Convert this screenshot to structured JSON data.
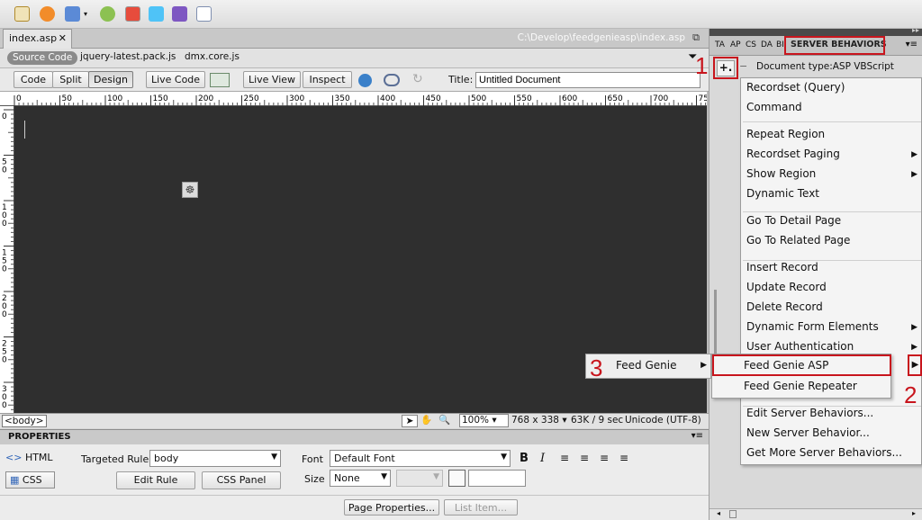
{
  "document": {
    "tabs": [
      {
        "label": "index.asp"
      }
    ],
    "path": "C:\\Develop\\feedgenieasp\\index.asp",
    "source_code": "Source Code",
    "related_files": [
      "jquery-latest.pack.js",
      "dmx.core.js"
    ]
  },
  "view_buttons": {
    "code": "Code",
    "split": "Split",
    "design": "Design",
    "live_code": "Live Code",
    "live_view": "Live View",
    "inspect": "Inspect",
    "title_label": "Title:",
    "title_value": "Untitled Document"
  },
  "ruler": {
    "h_ticks": [
      "0",
      "50",
      "100",
      "150",
      "200",
      "250",
      "300",
      "350",
      "400",
      "450",
      "500",
      "550",
      "600",
      "650",
      "700",
      "750"
    ],
    "v_ticks": [
      "0",
      "50",
      "100",
      "150",
      "200",
      "250",
      "300"
    ]
  },
  "status": {
    "tag": "<body>",
    "zoom": "100%",
    "size": "768 x 338",
    "download": "63K / 9 sec",
    "encoding": "Unicode (UTF-8)"
  },
  "properties": {
    "title": "PROPERTIES",
    "html_button": "HTML",
    "css_button": "CSS",
    "targeted_rule_label": "Targeted Rule",
    "targeted_rule_value": "body",
    "edit_rule": "Edit Rule",
    "css_panel": "CSS Panel",
    "font_label": "Font",
    "font_value": "Default Font",
    "size_label": "Size",
    "size_value": "None",
    "page_properties": "Page Properties...",
    "list_item": "List Item..."
  },
  "panel": {
    "tabs": [
      "TA",
      "AP",
      "CS",
      "DA",
      "BI"
    ],
    "active_tab": "SERVER BEHAVIORS",
    "plus": "+.",
    "minus": "−",
    "doc_type": "Document type:ASP VBScript"
  },
  "menu": {
    "items": [
      {
        "label": "Recordset (Query)",
        "sub": false
      },
      {
        "label": "Command",
        "sub": false
      },
      {
        "label": "Repeat Region",
        "sub": false
      },
      {
        "label": "Recordset Paging",
        "sub": true
      },
      {
        "label": "Show Region",
        "sub": true
      },
      {
        "label": "Dynamic Text",
        "sub": false
      },
      {
        "label": "Go To Detail Page",
        "sub": false
      },
      {
        "label": "Go To Related Page",
        "sub": false
      },
      {
        "label": "Insert Record",
        "sub": false
      },
      {
        "label": "Update Record",
        "sub": false
      },
      {
        "label": "Delete Record",
        "sub": false
      },
      {
        "label": "Dynamic Form Elements",
        "sub": true
      },
      {
        "label": "User Authentication",
        "sub": true
      },
      {
        "label": "Feed Genie ASP",
        "sub": true
      },
      {
        "label": "Feed Genie Repeater",
        "sub": false
      },
      {
        "label": "Edit Server Behaviors...",
        "sub": false
      },
      {
        "label": "New Server Behavior...",
        "sub": false
      },
      {
        "label": "Get More Server Behaviors...",
        "sub": false
      }
    ],
    "feed_genie": "Feed Genie",
    "step_numbers": [
      "1",
      "2",
      "3"
    ]
  },
  "colors": {
    "accent_red": "#c8151d",
    "design_bg": "#2f2f2f"
  }
}
